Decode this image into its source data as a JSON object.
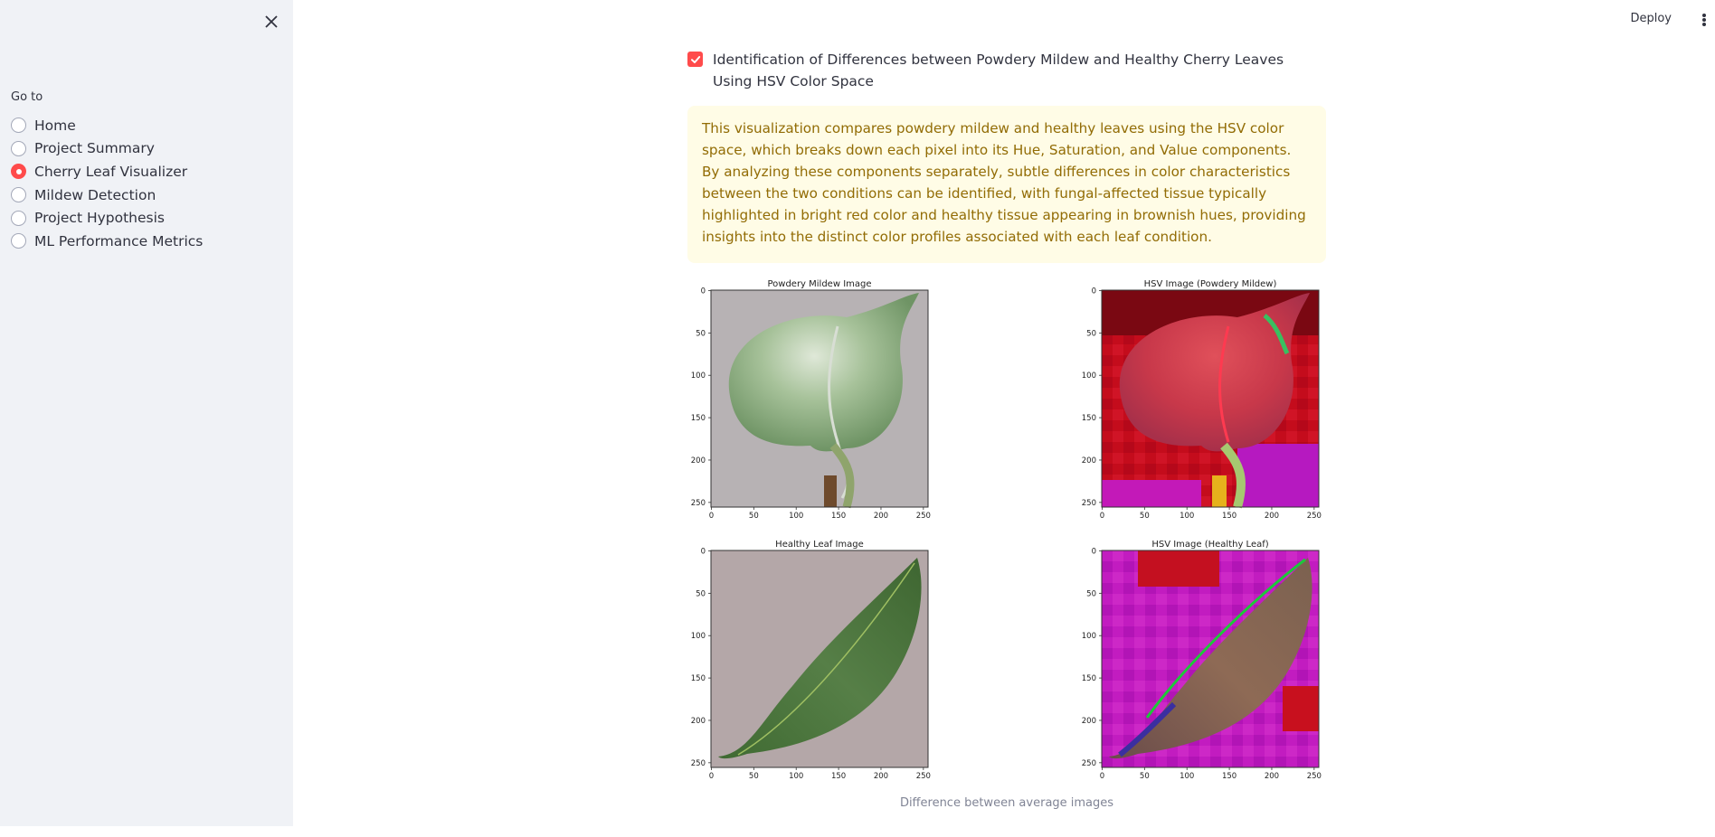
{
  "sidebar": {
    "goto_label": "Go to",
    "selected": "Cherry Leaf Visualizer",
    "items": [
      {
        "label": "Home",
        "selected": false
      },
      {
        "label": "Project Summary",
        "selected": false
      },
      {
        "label": "Cherry Leaf Visualizer",
        "selected": true
      },
      {
        "label": "Mildew Detection",
        "selected": false
      },
      {
        "label": "Project Hypothesis",
        "selected": false
      },
      {
        "label": "ML Performance Metrics",
        "selected": false
      }
    ]
  },
  "header": {
    "deploy_label": "Deploy",
    "menu_icon": "kebab-menu-icon"
  },
  "main": {
    "checkbox_label": "Identification of Differences between Powdery Mildew and Healthy Cherry Leaves Using HSV Color Space",
    "checkbox_checked": true,
    "info_text": "This visualization compares powdery mildew and healthy leaves using the HSV color space, which breaks down each pixel into its Hue, Saturation, and Value components. By analyzing these components separately, subtle differences in color characteristics between the two conditions can be identified, with fungal-affected tissue typically highlighted in bright red color and healthy tissue appearing in brownish hues, providing insights into the distinct color profiles associated with each leaf condition.",
    "caption": "Difference between average images"
  },
  "colors": {
    "accent": "#ff4b4b",
    "info_bg": "#fffce6",
    "info_text": "#926c05",
    "sidebar_bg": "#f0f2f6"
  },
  "figure": {
    "panels": [
      {
        "title": "Powdery Mildew Image",
        "kind": "mildew-rgb"
      },
      {
        "title": "HSV Image (Powdery Mildew)",
        "kind": "mildew-hsv"
      },
      {
        "title": "Healthy Leaf Image",
        "kind": "healthy-rgb"
      },
      {
        "title": "HSV Image (Healthy Leaf)",
        "kind": "healthy-hsv"
      }
    ],
    "x_ticks": [
      "0",
      "50",
      "100",
      "150",
      "200",
      "250"
    ],
    "y_ticks": [
      "0",
      "50",
      "100",
      "150",
      "200",
      "250"
    ]
  }
}
